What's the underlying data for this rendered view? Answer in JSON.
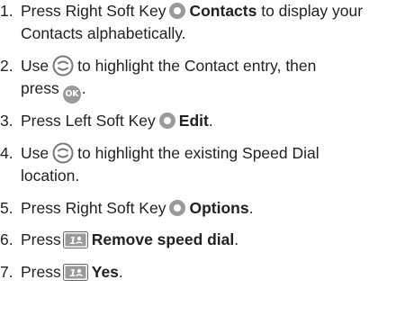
{
  "steps": [
    {
      "num": "1.",
      "line1_prefix": "Press Right Soft Key",
      "icon": "right-soft-key-icon",
      "bold": "Contacts",
      "line1_suffix": "to display your",
      "line2": "Contacts alphabetically."
    },
    {
      "num": "2.",
      "line1_prefix": "Use",
      "icon": "navigation-key-icon",
      "line1_suffix": "to highlight the Contact entry, then",
      "line2_prefix": "press",
      "icon2": "ok-key-icon",
      "icon2_text": "OK",
      "line2_suffix": "."
    },
    {
      "num": "3.",
      "line1_prefix": "Press Left Soft Key",
      "icon": "left-soft-key-icon",
      "bold": "Edit",
      "line1_suffix": "."
    },
    {
      "num": "4.",
      "line1_prefix": "Use",
      "icon": "navigation-key-icon",
      "line1_suffix": "to highlight the existing Speed Dial",
      "line2": "location."
    },
    {
      "num": "5.",
      "line1_prefix": "Press Right Soft Key",
      "icon": "right-soft-key-icon",
      "bold": "Options",
      "line1_suffix": "."
    },
    {
      "num": "6.",
      "line1_prefix": "Press",
      "icon": "number-1-key-icon",
      "bold": "Remove speed dial",
      "line1_suffix": "."
    },
    {
      "num": "7.",
      "line1_prefix": "Press",
      "icon": "number-1-key-icon",
      "bold": "Yes",
      "line1_suffix": "."
    }
  ],
  "colors": {
    "text": "#222222",
    "key_gray": "#9a9a9a"
  }
}
